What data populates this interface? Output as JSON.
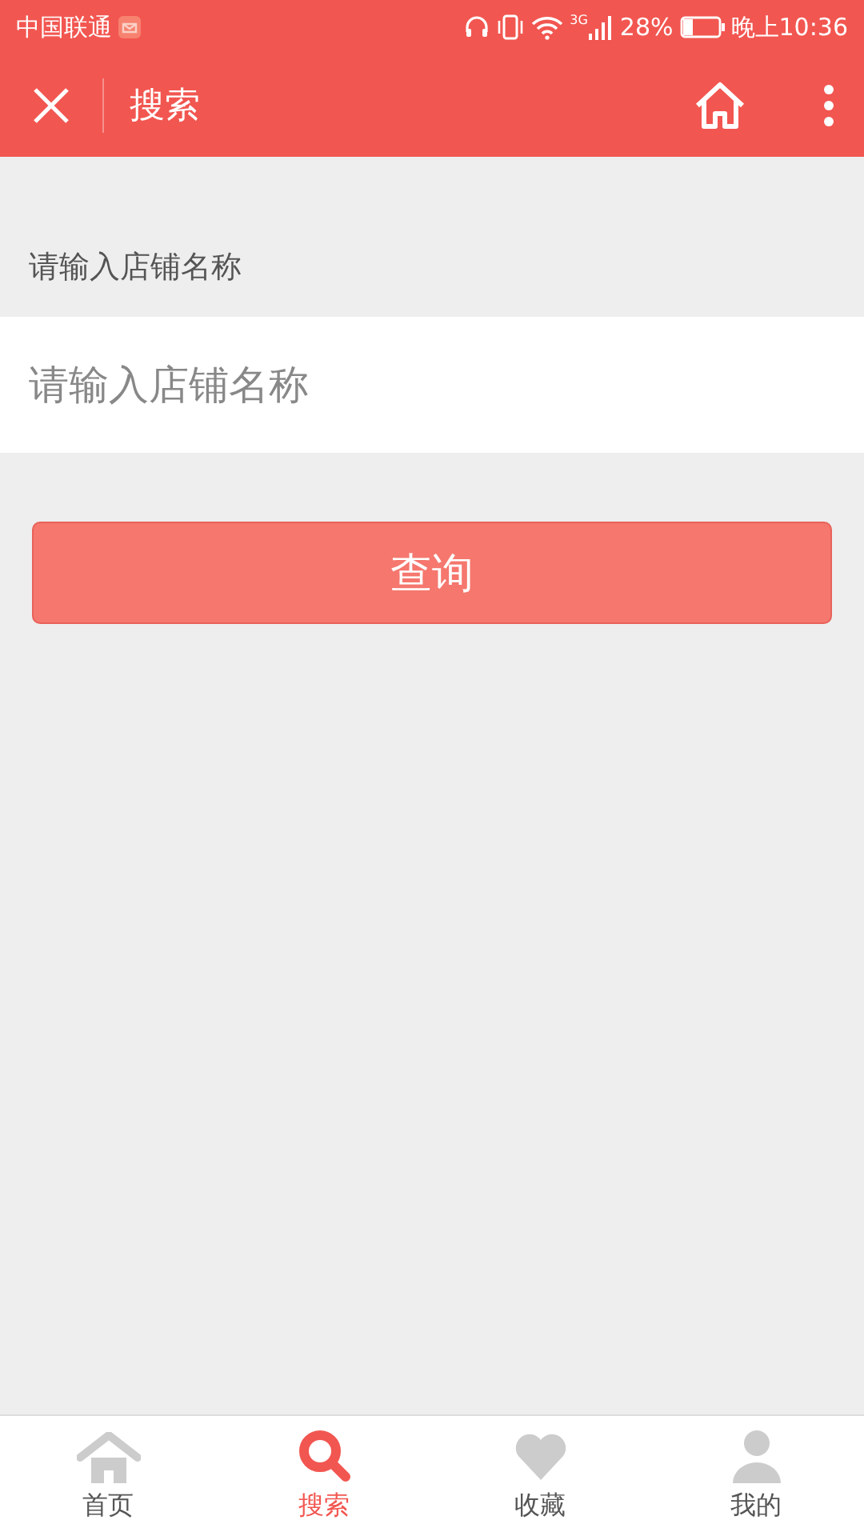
{
  "status_bar": {
    "carrier": "中国联通",
    "battery": "28%",
    "network": "3G",
    "time": "晚上10:36"
  },
  "nav_bar": {
    "title": "搜索"
  },
  "form": {
    "label": "请输入店铺名称",
    "input": {
      "placeholder": "请输入店铺名称"
    },
    "button": "查询"
  },
  "tab_bar": [
    {
      "label": "首页",
      "kind": "home",
      "selected": false
    },
    {
      "label": "搜索",
      "kind": "search",
      "selected": true
    },
    {
      "label": "收藏",
      "kind": "heart",
      "selected": false
    },
    {
      "label": "我的",
      "kind": "person",
      "selected": false
    }
  ]
}
